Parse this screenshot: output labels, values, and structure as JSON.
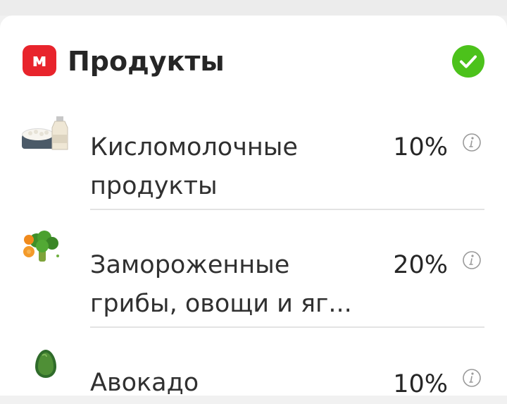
{
  "section": {
    "brand_letter": "м",
    "title": "Продукты",
    "brand_color": "#e8242c",
    "check_color": "#4cc21b"
  },
  "rows": [
    {
      "line1": "Кисломолочные",
      "line2": "продукты",
      "value": "10%",
      "icon": "dairy-products-icon"
    },
    {
      "line1": "Замороженные",
      "line2": "грибы, овощи и яг...",
      "value": "20%",
      "icon": "frozen-vegetables-icon"
    },
    {
      "line1": "Авокадо",
      "line2": "",
      "value": "10%",
      "icon": "avocado-icon"
    }
  ],
  "info_icon": "info-icon"
}
